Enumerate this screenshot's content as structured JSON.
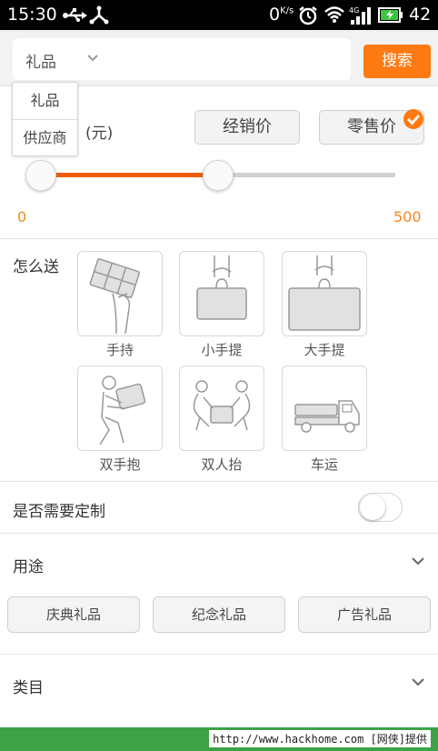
{
  "status_bar": {
    "time": "15:30",
    "network_speed": "0",
    "network_speed_unit": "K/s",
    "signal_type": "4G",
    "battery_level": "42",
    "icons": [
      "usb-icon",
      "share-icon",
      "alarm-icon",
      "wifi-icon",
      "signal-icon",
      "battery-icon"
    ]
  },
  "search": {
    "type_selected": "礼品",
    "button_label": "搜索"
  },
  "search_type_dropdown": {
    "options": [
      "礼品",
      "供应商"
    ]
  },
  "price": {
    "unit_label": "(元)",
    "dealer_price_label": "经销价",
    "retail_price_label": "零售价",
    "selected": "零售价",
    "range_min_label": "0",
    "range_max_label": "500",
    "slider_low": 0,
    "slider_high": 0.5
  },
  "delivery": {
    "label": "怎么送",
    "options": [
      {
        "label": "手持",
        "icon": "hand-carry-icon"
      },
      {
        "label": "小手提",
        "icon": "small-bag-icon"
      },
      {
        "label": "大手提",
        "icon": "large-bag-icon"
      },
      {
        "label": "双手抱",
        "icon": "two-arm-carry-icon"
      },
      {
        "label": "双人抬",
        "icon": "two-person-lift-icon"
      },
      {
        "label": "车运",
        "icon": "truck-icon"
      }
    ]
  },
  "customization": {
    "label": "是否需要定制",
    "enabled": false
  },
  "purpose": {
    "label": "用途",
    "options": [
      "庆典礼品",
      "纪念礼品",
      "广告礼品"
    ]
  },
  "category": {
    "label": "类目"
  },
  "watermark": {
    "text": "http://www.hackhome.com [网侠]提供"
  },
  "colors": {
    "accent": "#ff7a12",
    "slider_fill": "#ef5d0c",
    "price_text": "#f08a20",
    "footer_bg": "#3da246"
  }
}
